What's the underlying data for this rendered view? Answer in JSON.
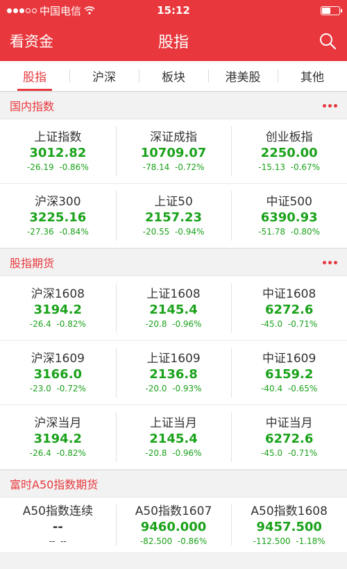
{
  "status": {
    "carrier": "中国电信",
    "time": "15:12"
  },
  "nav": {
    "left": "看资金",
    "title": "股指"
  },
  "tabs": [
    "股指",
    "沪深",
    "板块",
    "港美股",
    "其他"
  ],
  "sections": [
    {
      "title": "国内指数",
      "rows": [
        [
          {
            "name": "上证指数",
            "price": "3012.82",
            "change": "-26.19",
            "pct": "-0.86%"
          },
          {
            "name": "深证成指",
            "price": "10709.07",
            "change": "-78.14",
            "pct": "-0.72%"
          },
          {
            "name": "创业板指",
            "price": "2250.00",
            "change": "-15.13",
            "pct": "-0.67%"
          }
        ],
        [
          {
            "name": "沪深300",
            "price": "3225.16",
            "change": "-27.36",
            "pct": "-0.84%"
          },
          {
            "name": "上证50",
            "price": "2157.23",
            "change": "-20.55",
            "pct": "-0.94%"
          },
          {
            "name": "中证500",
            "price": "6390.93",
            "change": "-51.78",
            "pct": "-0.80%"
          }
        ]
      ]
    },
    {
      "title": "股指期货",
      "rows": [
        [
          {
            "name": "沪深1608",
            "price": "3194.2",
            "change": "-26.4",
            "pct": "-0.82%"
          },
          {
            "name": "上证1608",
            "price": "2145.4",
            "change": "-20.8",
            "pct": "-0.96%"
          },
          {
            "name": "中证1608",
            "price": "6272.6",
            "change": "-45.0",
            "pct": "-0.71%"
          }
        ],
        [
          {
            "name": "沪深1609",
            "price": "3166.0",
            "change": "-23.0",
            "pct": "-0.72%"
          },
          {
            "name": "上证1609",
            "price": "2136.8",
            "change": "-20.0",
            "pct": "-0.93%"
          },
          {
            "name": "中证1609",
            "price": "6159.2",
            "change": "-40.4",
            "pct": "-0.65%"
          }
        ],
        [
          {
            "name": "沪深当月",
            "price": "3194.2",
            "change": "-26.4",
            "pct": "-0.82%"
          },
          {
            "name": "上证当月",
            "price": "2145.4",
            "change": "-20.8",
            "pct": "-0.96%"
          },
          {
            "name": "中证当月",
            "price": "6272.6",
            "change": "-45.0",
            "pct": "-0.71%"
          }
        ]
      ]
    },
    {
      "title": "富时A50指数期货",
      "rows": [
        [
          {
            "name": "A50指数连续",
            "price": "--",
            "change": "--",
            "pct": "--"
          },
          {
            "name": "A50指数1607",
            "price": "9460.000",
            "change": "-82.500",
            "pct": "-0.86%"
          },
          {
            "name": "A50指数1608",
            "price": "9457.500",
            "change": "-112.500",
            "pct": "-1.18%"
          }
        ]
      ]
    }
  ]
}
